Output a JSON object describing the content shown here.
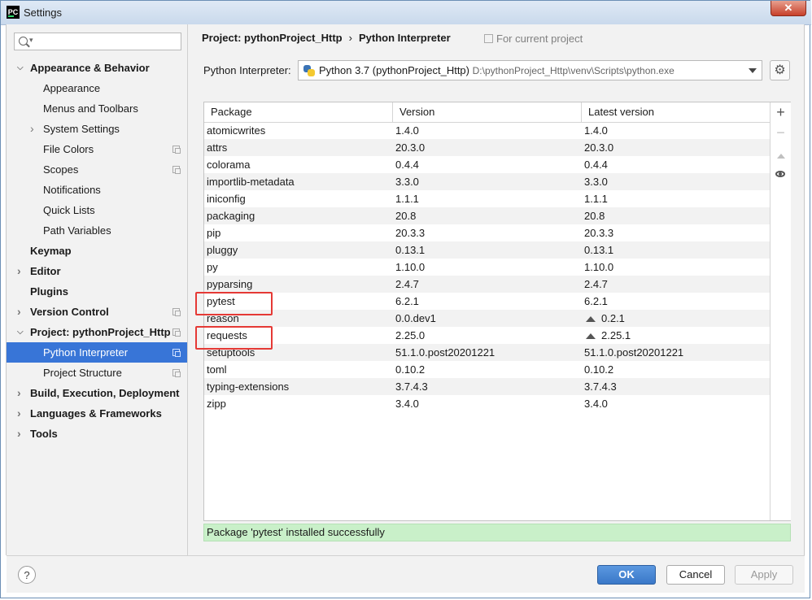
{
  "window": {
    "title": "Settings",
    "app_icon_text": "PC",
    "close_label": "✕"
  },
  "sidebar": {
    "search_placeholder": "",
    "items": [
      {
        "label": "Appearance & Behavior",
        "bold": true,
        "expanded": true
      },
      {
        "label": "Appearance"
      },
      {
        "label": "Menus and Toolbars"
      },
      {
        "label": "System Settings",
        "collapsed": true
      },
      {
        "label": "File Colors",
        "project_icon": true
      },
      {
        "label": "Scopes",
        "project_icon": true
      },
      {
        "label": "Notifications"
      },
      {
        "label": "Quick Lists"
      },
      {
        "label": "Path Variables"
      },
      {
        "label": "Keymap",
        "bold": true
      },
      {
        "label": "Editor",
        "bold": true,
        "collapsed": true
      },
      {
        "label": "Plugins",
        "bold": true
      },
      {
        "label": "Version Control",
        "bold": true,
        "collapsed": true,
        "project_icon": true
      },
      {
        "label": "Project: pythonProject_Http",
        "bold": true,
        "expanded": true,
        "project_icon": true
      },
      {
        "label": "Python Interpreter",
        "selected": true,
        "project_icon": true
      },
      {
        "label": "Project Structure",
        "project_icon": true
      },
      {
        "label": "Build, Execution, Deployment",
        "bold": true,
        "collapsed": true
      },
      {
        "label": "Languages & Frameworks",
        "bold": true,
        "collapsed": true
      },
      {
        "label": "Tools",
        "bold": true,
        "collapsed": true
      }
    ]
  },
  "header": {
    "breadcrumb_project": "Project: pythonProject_Http",
    "breadcrumb_separator": "›",
    "breadcrumb_page": "Python Interpreter",
    "scope_label": "For current project"
  },
  "interpreter": {
    "label": "Python Interpreter:",
    "name": "Python 3.7 (pythonProject_Http)",
    "path": "D:\\pythonProject_Http\\venv\\Scripts\\python.exe"
  },
  "table": {
    "columns": [
      "Package",
      "Version",
      "Latest version"
    ],
    "rows": [
      {
        "package": "atomicwrites",
        "version": "1.4.0",
        "latest": "1.4.0",
        "upgrade": false
      },
      {
        "package": "attrs",
        "version": "20.3.0",
        "latest": "20.3.0",
        "upgrade": false
      },
      {
        "package": "colorama",
        "version": "0.4.4",
        "latest": "0.4.4",
        "upgrade": false
      },
      {
        "package": "importlib-metadata",
        "version": "3.3.0",
        "latest": "3.3.0",
        "upgrade": false
      },
      {
        "package": "iniconfig",
        "version": "1.1.1",
        "latest": "1.1.1",
        "upgrade": false
      },
      {
        "package": "packaging",
        "version": "20.8",
        "latest": "20.8",
        "upgrade": false
      },
      {
        "package": "pip",
        "version": "20.3.3",
        "latest": "20.3.3",
        "upgrade": false
      },
      {
        "package": "pluggy",
        "version": "0.13.1",
        "latest": "0.13.1",
        "upgrade": false
      },
      {
        "package": "py",
        "version": "1.10.0",
        "latest": "1.10.0",
        "upgrade": false
      },
      {
        "package": "pyparsing",
        "version": "2.4.7",
        "latest": "2.4.7",
        "upgrade": false
      },
      {
        "package": "pytest",
        "version": "6.2.1",
        "latest": "6.2.1",
        "upgrade": false,
        "highlighted": true
      },
      {
        "package": "reason",
        "version": "0.0.dev1",
        "latest": "0.2.1",
        "upgrade": true
      },
      {
        "package": "requests",
        "version": "2.25.0",
        "latest": "2.25.1",
        "upgrade": true,
        "highlighted": true
      },
      {
        "package": "setuptools",
        "version": "51.1.0.post20201221",
        "latest": "51.1.0.post20201221",
        "upgrade": false
      },
      {
        "package": "toml",
        "version": "0.10.2",
        "latest": "0.10.2",
        "upgrade": false
      },
      {
        "package": "typing-extensions",
        "version": "3.7.4.3",
        "latest": "3.7.4.3",
        "upgrade": false
      },
      {
        "package": "zipp",
        "version": "3.4.0",
        "latest": "3.4.0",
        "upgrade": false
      }
    ],
    "tools": {
      "add_label": "+",
      "remove_label": "−"
    }
  },
  "status": {
    "message": "Package 'pytest' installed successfully",
    "color": "#c9f0c9"
  },
  "footer": {
    "help_label": "?",
    "ok_label": "OK",
    "cancel_label": "Cancel",
    "apply_label": "Apply"
  },
  "colors": {
    "selection": "#3875d7",
    "highlight_box": "#e53935",
    "ok_button": "#3a78c8"
  }
}
